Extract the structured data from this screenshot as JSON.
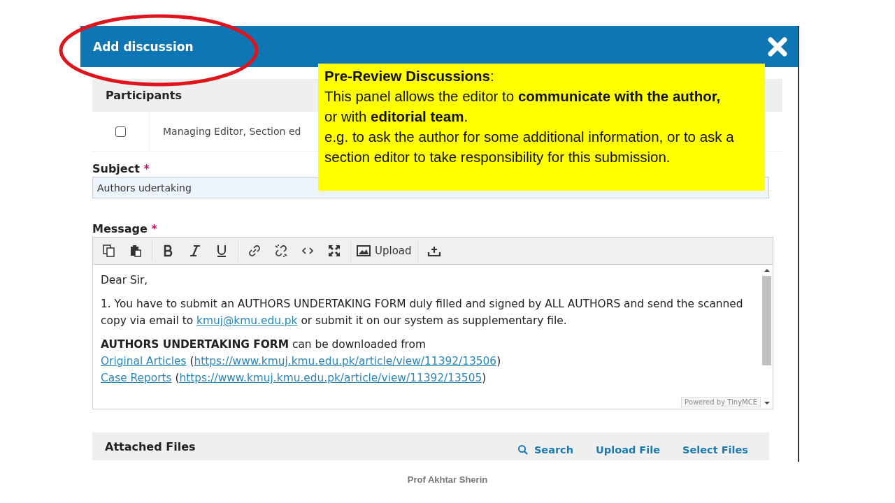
{
  "dialog": {
    "title": "Add discussion"
  },
  "participants": {
    "heading": "Participants",
    "rows": [
      {
        "label": "Managing Editor, Section ed",
        "checked": false
      }
    ]
  },
  "subject": {
    "label": "Subject",
    "required_mark": "*",
    "value": "Authors udertaking"
  },
  "message": {
    "label": "Message",
    "required_mark": "*",
    "upload_label": "Upload",
    "paragraphs": [
      {
        "segments": [
          {
            "kind": "text",
            "text": "Dear Sir,"
          }
        ]
      },
      {
        "segments": [
          {
            "kind": "text",
            "text": "1. You have to submit an AUTHORS UNDERTAKING FORM duly filled and signed by ALL AUTHORS and send the scanned copy via email to "
          },
          {
            "kind": "link",
            "text": "kmuj@kmu.edu.pk"
          },
          {
            "kind": "text",
            "text": " or submit it on our system as supplementary file."
          }
        ]
      },
      {
        "segments": [
          {
            "kind": "bold",
            "text": "AUTHORS UNDERTAKING FORM"
          },
          {
            "kind": "text",
            "text": " can be downloaded from"
          },
          {
            "kind": "break"
          },
          {
            "kind": "link",
            "text": "Original Articles"
          },
          {
            "kind": "text",
            "text": " ("
          },
          {
            "kind": "link",
            "text": "https://www.kmuj.kmu.edu.pk/article/view/11392/13506"
          },
          {
            "kind": "text",
            "text": ")"
          },
          {
            "kind": "break"
          },
          {
            "kind": "link",
            "text": "Case Reports"
          },
          {
            "kind": "text",
            "text": " ("
          },
          {
            "kind": "link",
            "text": "https://www.kmuj.kmu.edu.pk/article/view/11392/13505"
          },
          {
            "kind": "text",
            "text": ")"
          }
        ]
      }
    ],
    "powered_by": "Powered by TinyMCE"
  },
  "attached_files": {
    "heading": "Attached Files",
    "actions": [
      {
        "kind": "search",
        "label": "Search"
      },
      {
        "kind": "plain",
        "label": "Upload File"
      },
      {
        "kind": "plain",
        "label": "Select Files"
      }
    ]
  },
  "callout": {
    "lines": [
      "**Pre-Review Discussions**:",
      "This panel allows the editor to **communicate with the author,** or with **editorial team**.",
      "e.g. to ask the author for some additional information, or to ask a section editor to take responsibility for this submission."
    ]
  },
  "footer": "Prof Akhtar Sherin"
}
